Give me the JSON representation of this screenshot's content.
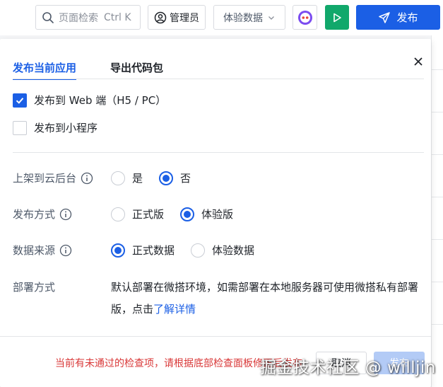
{
  "colors": {
    "accent": "#1b5fe5",
    "run": "#11a86b",
    "warning": "#d93838",
    "disabled_primary": "#b3cbf6"
  },
  "toolbar": {
    "search_placeholder": "页面检索",
    "search_shortcut": "Ctrl K",
    "search_icon": "search-icon",
    "admin_label": "管理员",
    "data_select_value": "体验数据",
    "avatar_icon": "robot-avatar-icon",
    "run_icon": "play-icon",
    "publish_label": "发布"
  },
  "dialog": {
    "tabs": [
      {
        "label": "发布当前应用",
        "active": true
      },
      {
        "label": "导出代码包",
        "active": false
      }
    ],
    "targets": [
      {
        "label": "发布到 Web 端（H5 / PC）",
        "checked": true
      },
      {
        "label": "发布到小程序",
        "checked": false
      }
    ],
    "fields": {
      "cloud": {
        "label": "上架到云后台",
        "options": [
          {
            "label": "是",
            "selected": false
          },
          {
            "label": "否",
            "selected": true
          }
        ]
      },
      "mode": {
        "label": "发布方式",
        "options": [
          {
            "label": "正式版",
            "selected": false
          },
          {
            "label": "体验版",
            "selected": true
          }
        ]
      },
      "source": {
        "label": "数据来源",
        "options": [
          {
            "label": "正式数据",
            "selected": true
          },
          {
            "label": "体验数据",
            "selected": false
          }
        ]
      },
      "deploy": {
        "label": "部署方式",
        "text": "默认部署在微搭环境，如需部署在本地服务器可使用微搭私有部署版，点击",
        "link": "了解详情"
      }
    },
    "footer": {
      "warning": "当前有未通过的检查项，请根据底部检查面板修正后发布",
      "cancel": "取消",
      "confirm": "发布"
    }
  },
  "watermark": "掘金技术社区 @ willjin"
}
